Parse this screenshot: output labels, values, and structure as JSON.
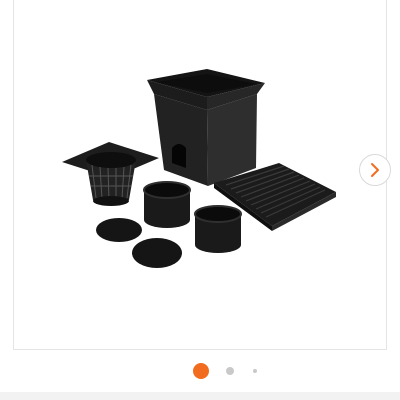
{
  "gallery": {
    "image": {
      "icon": "product-photo",
      "items": [
        "square-catch-basin",
        "mesh-filter-basket",
        "grate-cover",
        "riser-ring-1",
        "riser-ring-2",
        "end-cap-1",
        "end-cap-2"
      ]
    },
    "next_button": {
      "icon": "chevron-right-icon"
    },
    "pagination": {
      "count": 3,
      "active_index": 0,
      "active_color": "#f26c1f",
      "inactive_color": "#c9c9c9"
    }
  }
}
